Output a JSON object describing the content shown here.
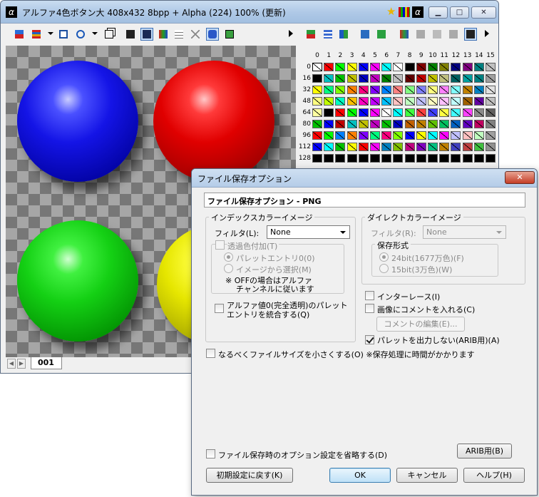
{
  "main_window": {
    "title": "アルファ4色ボタン大  408x432  8bpp + Alpha (224)  100%  (更新)",
    "minimize_label": "▁",
    "maximize_label": "□",
    "close_label": "✕",
    "tab_label": "001",
    "tab_prev": "◀",
    "tab_next": "▶"
  },
  "palette": {
    "column_numbers": [
      "0",
      "1",
      "2",
      "3",
      "4",
      "5",
      "6",
      "7",
      "8",
      "9",
      "10",
      "11",
      "12",
      "13",
      "14",
      "15"
    ],
    "row_numbers": [
      "0",
      "16",
      "32",
      "48",
      "64",
      "80",
      "96",
      "112",
      "128"
    ],
    "rows": [
      [
        "#ffffff",
        "#ff0000",
        "#00ff00",
        "#ffff00",
        "#0000ff",
        "#ff00ff",
        "#00ffff",
        "#ffffff",
        "#000000",
        "#800000",
        "#008000",
        "#808000",
        "#000080",
        "#800080",
        "#008080",
        "#c0c0c0"
      ],
      [
        "#000000",
        "#00c0c0",
        "#00c000",
        "#c0c000",
        "#0000c0",
        "#c000c0",
        "#008000",
        "#c0c0c0",
        "#600000",
        "#c00000",
        "#c0c000",
        "#c0c080",
        "#006060",
        "#00a0a0",
        "#008080",
        "#a0a0a0"
      ],
      [
        "#ffff00",
        "#00ff80",
        "#80ff00",
        "#ff8000",
        "#ff0080",
        "#8000ff",
        "#0080ff",
        "#ff8080",
        "#80ff80",
        "#8080ff",
        "#ffff80",
        "#ff80ff",
        "#80ffff",
        "#c08000",
        "#0080c0",
        "#e0e0e0"
      ],
      [
        "#ffff80",
        "#c0ff00",
        "#00ffc0",
        "#ffc000",
        "#ff00c0",
        "#c000ff",
        "#00c0ff",
        "#ffc0c0",
        "#c0ffc0",
        "#c0c0ff",
        "#ffffc0",
        "#ffc0ff",
        "#c0ffff",
        "#a06000",
        "#6000a0",
        "#c0c0c0"
      ],
      [
        "#ffffa0",
        "#000000",
        "#ff0000",
        "#00ff00",
        "#0000ff",
        "#ff00ff",
        "#ffffff",
        "#00ffff",
        "#40ff40",
        "#ff4040",
        "#4040ff",
        "#ffff40",
        "#40ffff",
        "#ff40ff",
        "#8a8a8a",
        "#606060"
      ],
      [
        "#00c000",
        "#0000ff",
        "#c00000",
        "#00c0c0",
        "#c0c000",
        "#c000c0",
        "#00c000",
        "#0000c0",
        "#c06000",
        "#c08000",
        "#60c000",
        "#00c060",
        "#0060c0",
        "#6000c0",
        "#c00060",
        "#808080"
      ],
      [
        "#ff0000",
        "#00ff00",
        "#0080ff",
        "#ff8000",
        "#8000ff",
        "#00ff80",
        "#ff0080",
        "#80ff00",
        "#0000ff",
        "#ffff00",
        "#00ffff",
        "#ff00ff",
        "#c0c0ff",
        "#ffc0c0",
        "#c0ffc0",
        "#a0a0a0"
      ],
      [
        "#0000ff",
        "#00ffff",
        "#00c000",
        "#ffff00",
        "#ff0000",
        "#ff00ff",
        "#0080c0",
        "#80c000",
        "#c00080",
        "#8000c0",
        "#00c080",
        "#c08000",
        "#4040c0",
        "#c04040",
        "#40c040",
        "#909090"
      ],
      [
        "#000000",
        "#000000",
        "#000000",
        "#000000",
        "#000000",
        "#000000",
        "#000000",
        "#000000",
        "#000000",
        "#000000",
        "#000000",
        "#000000",
        "#000000",
        "#000000",
        "#000000",
        "#000000"
      ]
    ]
  },
  "dialog": {
    "title": "ファイル保存オプション",
    "close_label": "✕",
    "header": "ファイル保存オプション - PNG",
    "indexed": {
      "group_label": "インデックスカラーイメージ",
      "filter_label": "フィルタ(L):",
      "filter_value": "None",
      "transparent_label": "透過色付加(T)",
      "radio_palette0": "パレットエントリ0(0)",
      "radio_from_image": "イメージから選択(M)",
      "note_line1": "※ OFFの場合はアルファ",
      "note_line2": "チャンネルに従います",
      "merge_line1": "アルファ値0(完全透明)のパレット",
      "merge_line2": "エントリを統合する(Q)"
    },
    "direct": {
      "group_label": "ダイレクトカラーイメージ",
      "filter_label": "フィルタ(R):",
      "filter_value": "None",
      "format_label": "保存形式",
      "radio_24": "24bit(1677万色)(F)",
      "radio_15": "15bit(3万色)(W)"
    },
    "interlace_label": "インターレース(I)",
    "comment_label": "画像にコメントを入れる(C)",
    "edit_comment_button": "コメントの編集(E)...",
    "no_palette_label": "パレットを出力しない(ARIB用)(A)",
    "no_palette_checked": true,
    "smaller_file_label": "なるべくファイルサイズを小さくする(O)  ※保存処理に時間がかかります",
    "arib_button": "ARIB用(B)",
    "skip_options_label": "ファイル保存時のオプション設定を省略する(D)",
    "reset_button": "初期設定に戻す(K)",
    "ok_button": "OK",
    "cancel_button": "キャンセル",
    "help_button": "ヘルプ(H)"
  }
}
